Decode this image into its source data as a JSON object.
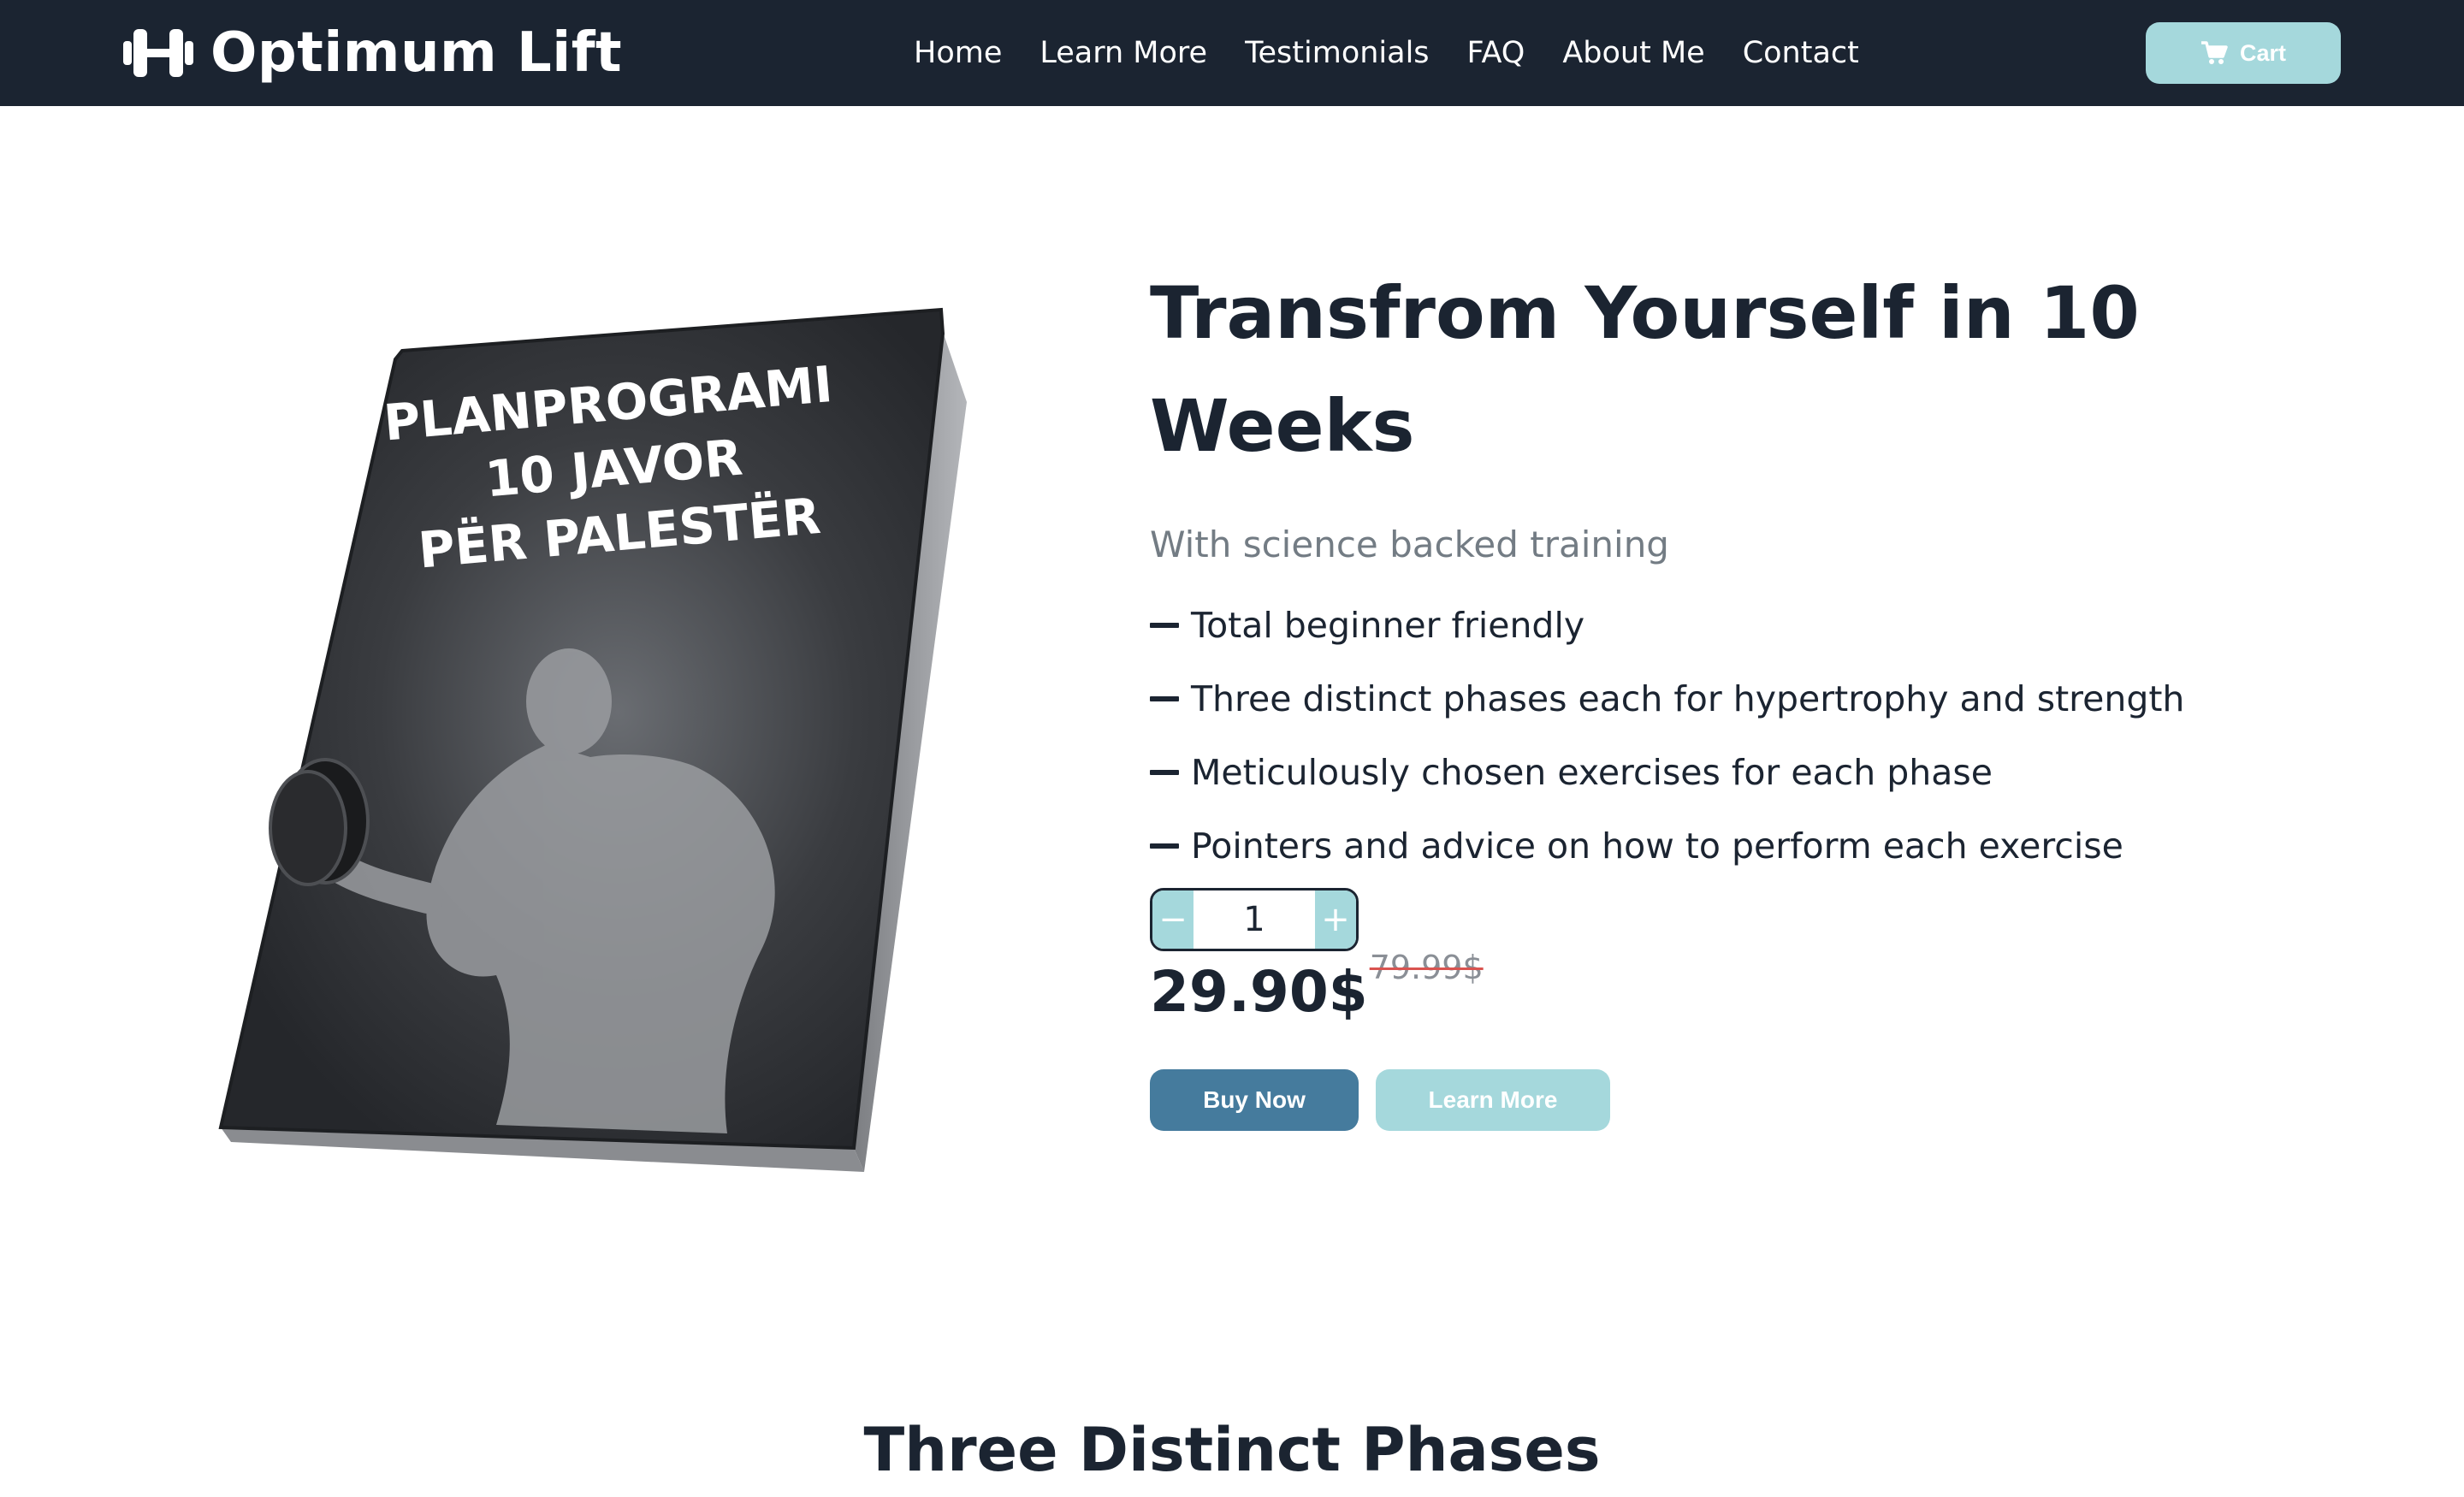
{
  "brand": {
    "name": "Optimum Lift",
    "icon": "dumbbell-icon"
  },
  "nav": {
    "links": [
      "Home",
      "Learn More",
      "Testimonials",
      "FAQ",
      "About Me",
      "Contact"
    ],
    "cart_label": "Cart",
    "cart_icon": "cart-icon"
  },
  "product": {
    "image_text": [
      "PLANPROGRAMI",
      "10 JAVOR",
      "PËR PALESTËR"
    ],
    "title": "Transfrom Yourself in 10 Weeks",
    "subtitle": "With science backed training",
    "features": [
      "Total beginner friendly",
      "Three distinct phases each for hypertrophy and strength",
      "Meticulously chosen exercises for each phase",
      "Pointers and advice on how to perform each exercise"
    ],
    "quantity": {
      "value": "1",
      "minus_label": "−",
      "plus_label": "+"
    },
    "price": "29.90$",
    "old_price": "79.99$",
    "buy_label": "Buy Now",
    "learn_label": "Learn More"
  },
  "section": {
    "heading": "Three Distinct Phases"
  },
  "colors": {
    "navbar": "#1b2431",
    "accent_light": "#a5d8dc",
    "accent_dark": "#457b9d",
    "text": "#1b2431",
    "muted": "#737c84",
    "strike": "#d9534f"
  }
}
